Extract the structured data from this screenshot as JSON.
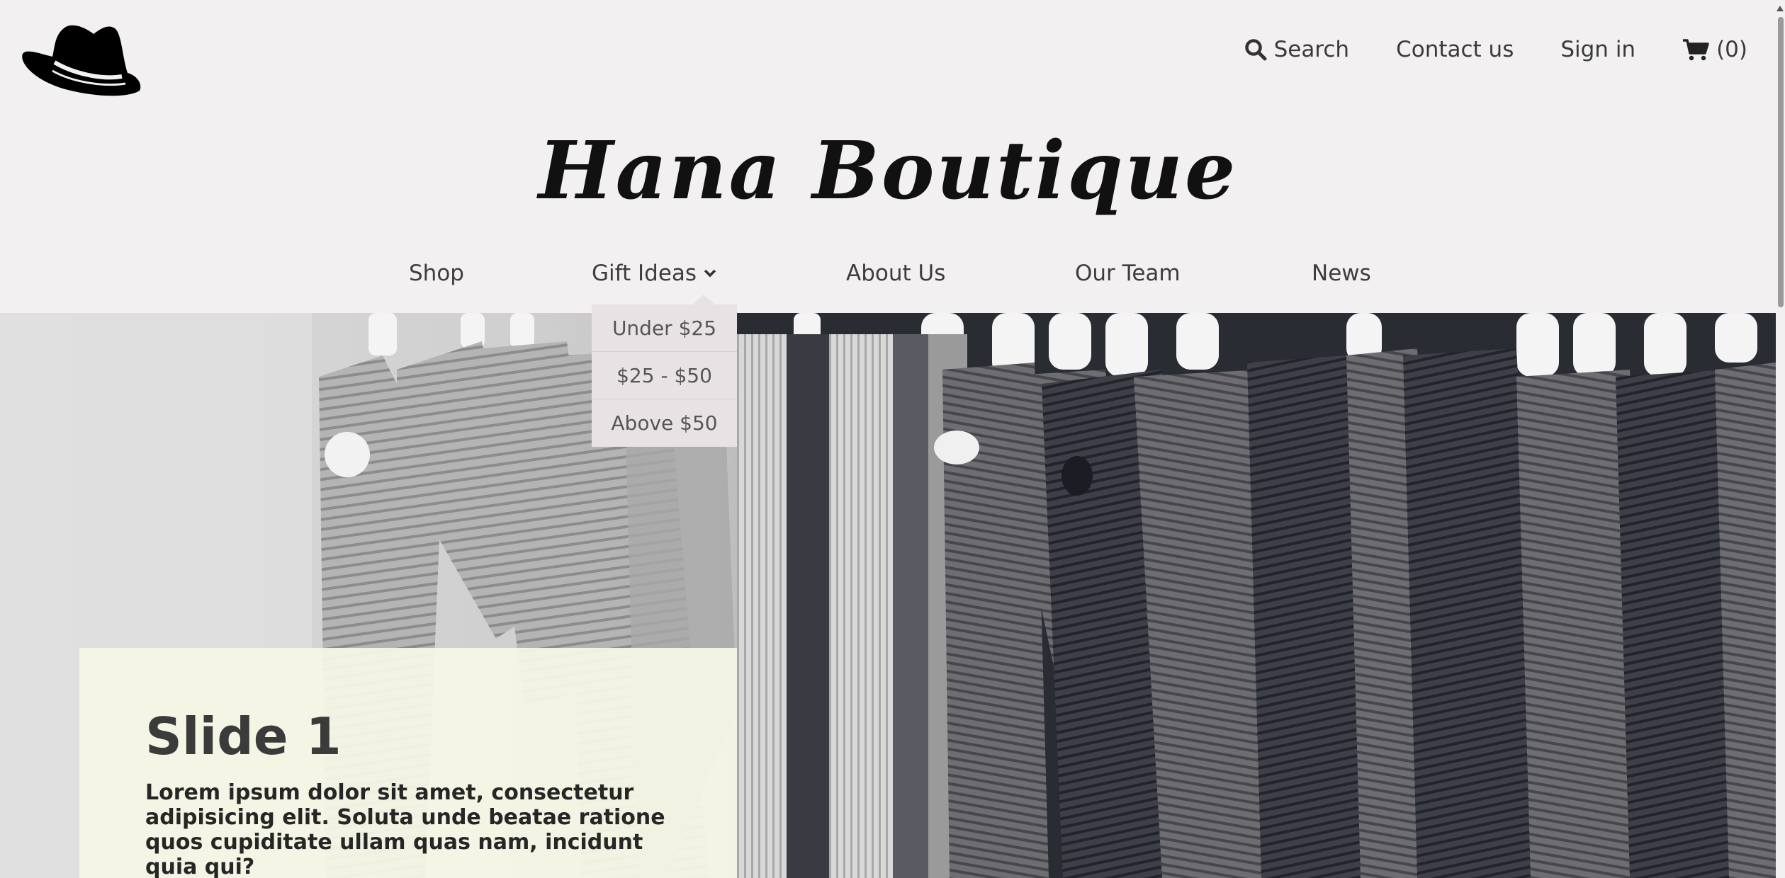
{
  "header": {
    "logo_icon": "cowboy-hat-icon",
    "brand_name": "Hana Boutique"
  },
  "util_nav": {
    "search_icon": "search-icon",
    "search_label": "Search",
    "contact_label": "Contact us",
    "signin_label": "Sign in",
    "cart_icon": "shopping-cart-icon",
    "cart_count": "(0)"
  },
  "main_nav": {
    "items": [
      {
        "label": "Shop"
      },
      {
        "label": "Gift Ideas",
        "icon": "chevron-down-icon"
      },
      {
        "label": "About Us"
      },
      {
        "label": "Our Team"
      },
      {
        "label": "News"
      }
    ]
  },
  "gift_dropdown": {
    "items": [
      {
        "label": "Under $25"
      },
      {
        "label": "$25 - $50"
      },
      {
        "label": "Above $50"
      }
    ]
  },
  "hero": {
    "image": "clothing-rack-photo",
    "slide_title": "Slide 1",
    "slide_text": "Lorem ipsum dolor sit amet, consectetur adipisicing elit. Soluta unde beatae ratione quos cupiditate ullam quas nam, incidunt quia qui?"
  },
  "colors": {
    "page_bg": "#f2f0f1",
    "dropdown_bg": "#e7e3e4",
    "slide_card_bg": "#f6f7e6",
    "text_dark": "#333333"
  }
}
